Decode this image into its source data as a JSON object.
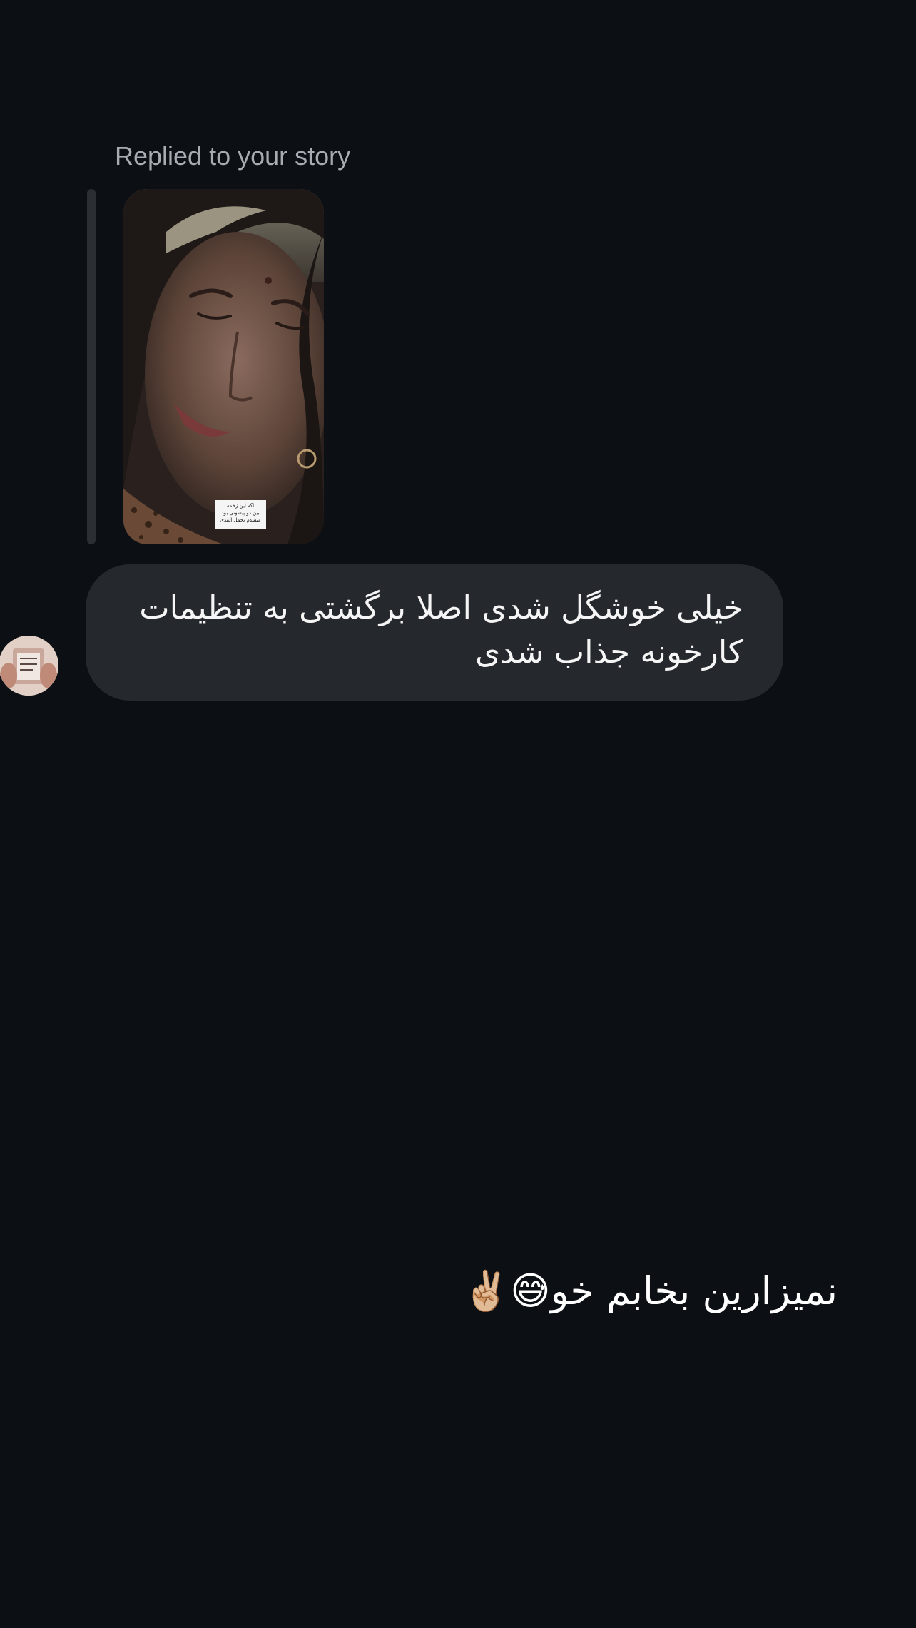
{
  "thread": {
    "reply_label": "Replied to your story",
    "story": {
      "sticker_lines": [
        "اگه این زخمه",
        "بین دو پیشونی بود",
        "میشدم تحمل الفدی"
      ]
    },
    "received_message": {
      "text": "خیلی خوشگل شدی اصلا برگشتی به تنظیمات کارخونه جذاب شدی"
    },
    "sent_message": {
      "text": "نمیزارین بخابم خو😅✌🏼"
    }
  },
  "colors": {
    "background": "#0c1014",
    "bubble": "#25282d",
    "quote_bar": "#2b2e33",
    "secondary_text": "#a8abb1",
    "primary_text": "#f5f5f5"
  }
}
